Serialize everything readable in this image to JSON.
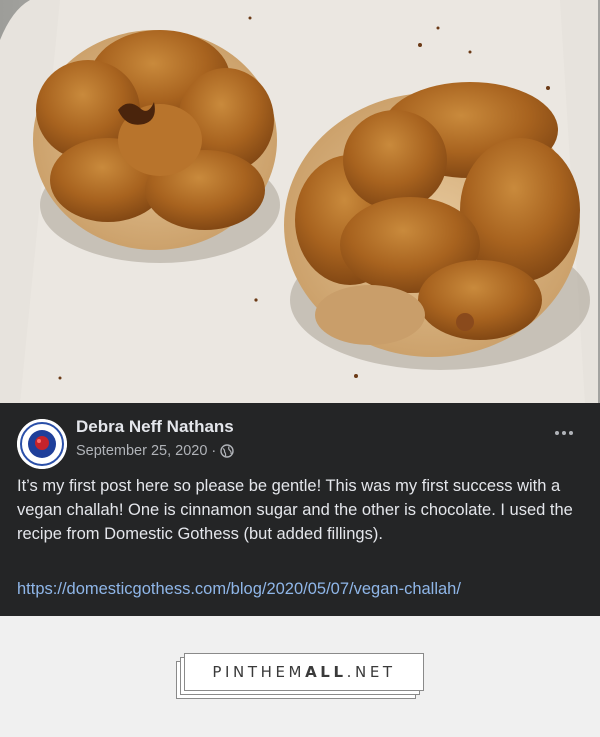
{
  "post": {
    "author": "Debra Neff Nathans",
    "date": "September 25, 2020",
    "separator": "·",
    "audience_icon": "globe-icon",
    "more_icon": "more-options-icon",
    "body": "It’s my first post here so please be gentle! This was my first success with a vegan challah! One is cinnamon sugar and the other is chocolate. I used the recipe from Domestic Gothess (but added fillings).",
    "link": "https://domesticgothess.com/blog/2020/05/07/vegan-challah/"
  },
  "footer": {
    "brand_part1": "PINTHEM",
    "brand_part2": "ALL",
    "brand_part3": ".NET"
  },
  "colors": {
    "post_bg": "#242526",
    "text": "#e4e6eb",
    "secondary_text": "#b0b3b8",
    "link": "#8fb6e8",
    "footer_bg": "#f0f0f0"
  }
}
